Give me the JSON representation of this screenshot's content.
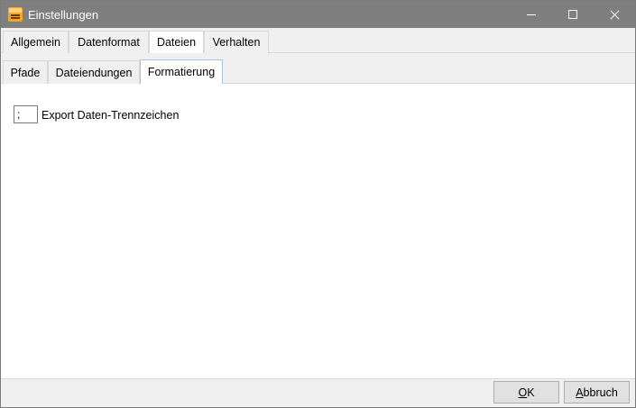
{
  "window": {
    "title": "Einstellungen",
    "icon": "app-icon",
    "controls": [
      "minimize-icon",
      "maximize-icon",
      "close-icon"
    ]
  },
  "main_tabs": [
    {
      "label": "Allgemein",
      "active": false
    },
    {
      "label": "Datenformat",
      "active": false
    },
    {
      "label": "Dateien",
      "active": true
    },
    {
      "label": "Verhalten",
      "active": false
    }
  ],
  "sub_tabs": [
    {
      "label": "Pfade",
      "active": false
    },
    {
      "label": "Dateiendungen",
      "active": false
    },
    {
      "label": "Formatierung",
      "active": true
    }
  ],
  "formatierung": {
    "separator_value": ";",
    "separator_label": "Export Daten-Trennzeichen"
  },
  "footer": {
    "ok_mnemonic": "O",
    "ok_rest": "K",
    "cancel_mnemonic": "A",
    "cancel_rest": "bbruch"
  }
}
